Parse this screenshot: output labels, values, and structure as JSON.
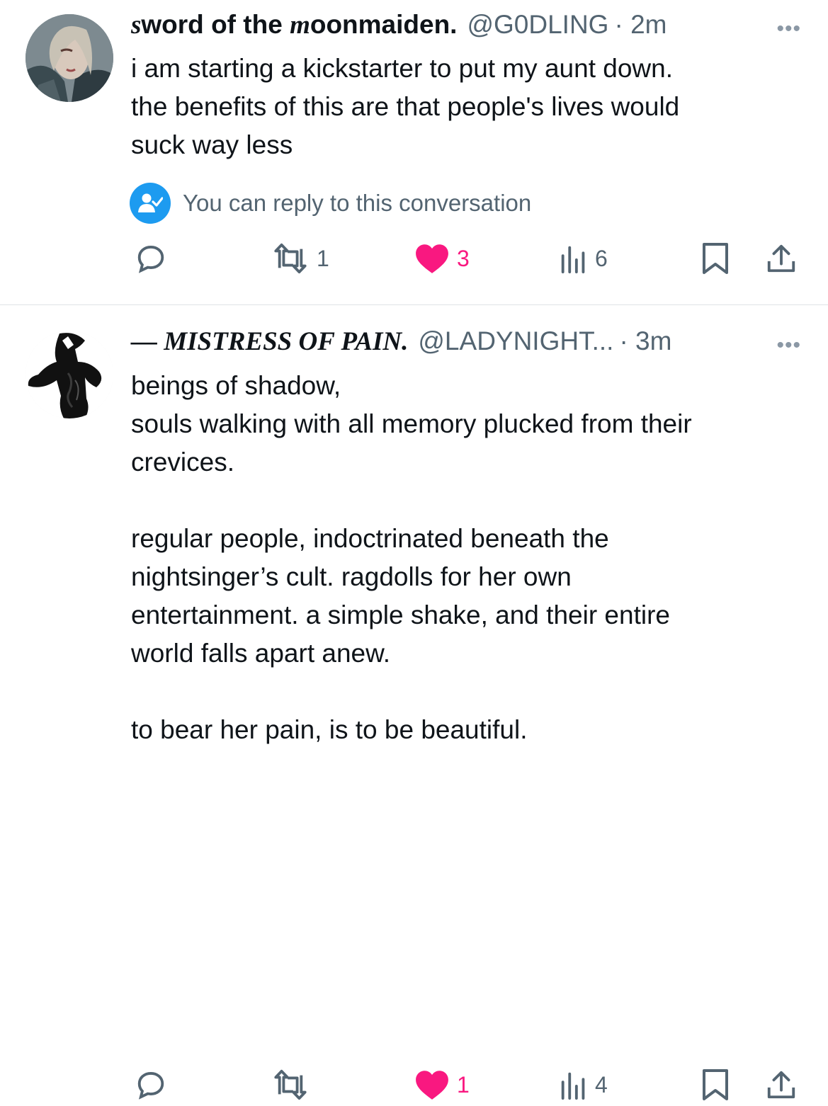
{
  "tweets": [
    {
      "name_start": "s",
      "name_bold": "word of the ",
      "name_m": "m",
      "name_end": "oonmaiden.",
      "handle": "@G0DLING",
      "time": "· 2m",
      "more": "•••",
      "lines": [
        "i am starting a kickstarter to put my aunt down.",
        "the benefits of this are that people's lives would",
        "suck way less"
      ],
      "conversation_note": "You can reply to this conversation",
      "actions": {
        "reply": "",
        "retweet": "1",
        "like": "3",
        "views": "6"
      },
      "liked": true
    },
    {
      "name": "— MISTRESS OF PAIN.",
      "handle": "@LADYNIGHT...",
      "time": "· 3m",
      "more": "•••",
      "lines": [
        "beings of shadow,",
        "souls walking with all memory plucked from their",
        "crevices.",
        "",
        "regular people, indoctrinated beneath the",
        "nightsinger’s cult. ragdolls for her own",
        "entertainment. a simple shake, and their entire",
        "world falls apart anew.",
        "",
        "to bear her pain, is to be beautiful."
      ],
      "actions": {
        "reply": "",
        "retweet": "",
        "like": "1",
        "views": "4"
      },
      "liked": true
    }
  ],
  "colors": {
    "text": "#0f1419",
    "muted": "#536471",
    "like": "#f91880",
    "accent": "#1d9bf0",
    "divider": "#dfe3e6"
  }
}
